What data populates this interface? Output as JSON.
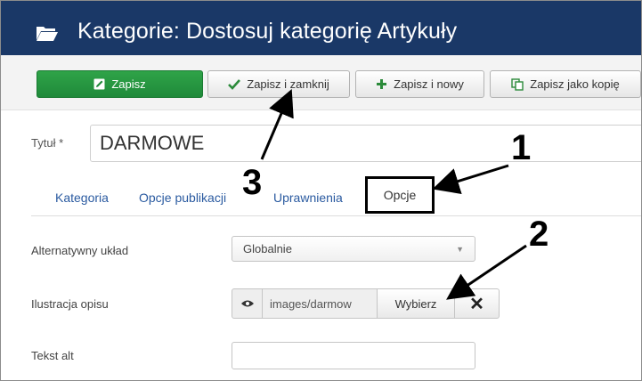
{
  "header": {
    "title": "Kategorie: Dostosuj kategorię Artykuły",
    "icon": "folder-open-icon",
    "background": "#1a3867"
  },
  "toolbar": {
    "save": "Zapisz",
    "save_close": "Zapisz i zamknij",
    "save_new": "Zapisz i nowy",
    "save_copy": "Zapisz jako kopię",
    "save_color": "#2fa348"
  },
  "form": {
    "title_label": "Tytuł *",
    "title_value": "DARMOWE"
  },
  "tabs": [
    {
      "label": "Kategoria"
    },
    {
      "label": "Opcje publikacji"
    },
    {
      "label": "Uprawnienia"
    },
    {
      "label": "Opcje",
      "active": true
    }
  ],
  "options": {
    "layout_label": "Alternatywny układ",
    "layout_value": "Globalnie",
    "image_label": "Ilustracja opisu",
    "image_path": "images/darmow",
    "image_select": "Wybierz",
    "alt_label": "Tekst alt",
    "alt_value": ""
  },
  "annotations": [
    "1",
    "2",
    "3"
  ]
}
